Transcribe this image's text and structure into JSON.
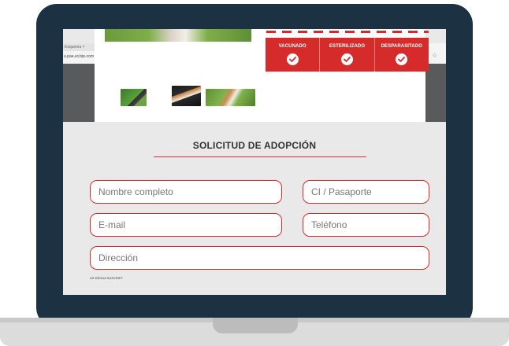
{
  "browser": {
    "tab_title": "Esquema ×",
    "url_fragment": "u.pae.ec/sip-com",
    "bookmark_icon": "star-icon"
  },
  "badges": [
    {
      "label": "VACUNADO",
      "icon": "check-icon"
    },
    {
      "label": "ESTERILIZADO",
      "icon": "check-icon"
    },
    {
      "label": "DESPARASITADO",
      "icon": "check-icon"
    }
  ],
  "colors": {
    "accent": "#d62b2b",
    "laptop_frame": "#1c3142",
    "form_background": "#e9e9e9"
  },
  "form": {
    "title": "SOLICITUD DE ADOPCIÓN",
    "fields": {
      "nombre": {
        "placeholder": "Nombre completo",
        "value": ""
      },
      "ci": {
        "placeholder": "CI / Pasaporte",
        "value": ""
      },
      "email": {
        "placeholder": "E-mail",
        "value": ""
      },
      "telefono": {
        "placeholder": "Teléfono",
        "value": ""
      },
      "direccion": {
        "placeholder": "Dirección",
        "value": ""
      }
    },
    "fine_print_link": "US DÉGUA SUSCRIPT"
  }
}
